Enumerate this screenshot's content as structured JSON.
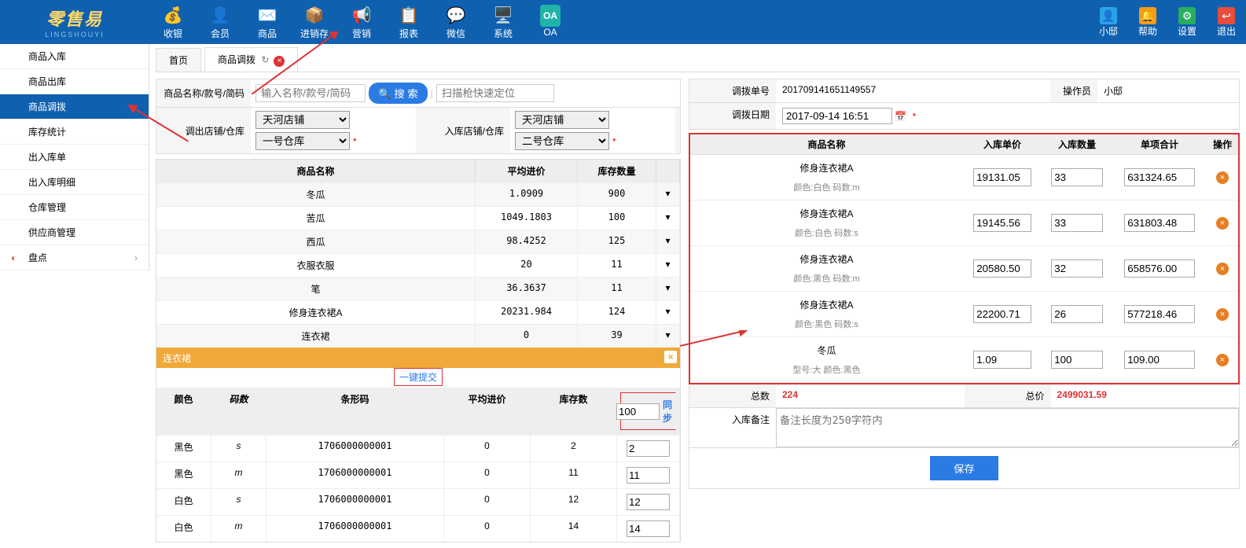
{
  "brand": {
    "name": "零售易",
    "sub": "LINGSHOUYI"
  },
  "topnav": [
    {
      "icon": "💰",
      "label": "收银"
    },
    {
      "icon": "👤",
      "label": "会员"
    },
    {
      "icon": "✉️",
      "label": "商品"
    },
    {
      "icon": "📦",
      "label": "进销存"
    },
    {
      "icon": "📢",
      "label": "营销"
    },
    {
      "icon": "📋",
      "label": "报表"
    },
    {
      "icon": "💬",
      "label": "微信"
    },
    {
      "icon": "🖥️",
      "label": "系统"
    },
    {
      "icon": "OA",
      "label": "OA",
      "oa": true
    }
  ],
  "topnav_right": [
    {
      "icon": "👤",
      "label": "小邸",
      "color": "#2aa3e6"
    },
    {
      "icon": "🔔",
      "label": "帮助",
      "color": "#f39c12"
    },
    {
      "icon": "⚙",
      "label": "设置",
      "color": "#27ae60"
    },
    {
      "icon": "↩",
      "label": "退出",
      "color": "#e74c3c"
    }
  ],
  "sidebar": [
    {
      "label": "商品入库"
    },
    {
      "label": "商品出库"
    },
    {
      "label": "商品调拨",
      "active": true
    },
    {
      "label": "库存统计"
    },
    {
      "label": "出入库单"
    },
    {
      "label": "出入库明细"
    },
    {
      "label": "仓库管理"
    },
    {
      "label": "供应商管理"
    },
    {
      "label": "盘点",
      "group": true
    }
  ],
  "tabs": [
    {
      "label": "首页"
    },
    {
      "label": "商品调拨",
      "active": true,
      "closable": true
    }
  ],
  "search": {
    "label": "商品名称/款号/简码",
    "placeholder": "输入名称/款号/简码",
    "button": "搜 索",
    "scan_placeholder": "扫描枪快速定位"
  },
  "store": {
    "out_label": "调出店铺/仓库",
    "in_label": "入库店铺/仓库",
    "out_store": "天河店铺",
    "out_wh": "一号仓库",
    "in_store": "天河店铺",
    "in_wh": "二号仓库"
  },
  "grid_head": {
    "name": "商品名称",
    "price": "平均进价",
    "qty": "库存数量"
  },
  "grid": [
    {
      "name": "冬瓜",
      "price": "1.0909",
      "qty": "900"
    },
    {
      "name": "苦瓜",
      "price": "1049.1803",
      "qty": "100"
    },
    {
      "name": "西瓜",
      "price": "98.4252",
      "qty": "125"
    },
    {
      "name": "衣服衣服",
      "price": "20",
      "qty": "11"
    },
    {
      "name": "笔",
      "price": "36.3637",
      "qty": "11"
    },
    {
      "name": "修身连衣裙A",
      "price": "20231.984",
      "qty": "124"
    },
    {
      "name": "连衣裙",
      "price": "0",
      "qty": "39"
    }
  ],
  "expand": {
    "title": "连衣裙",
    "oneclick": "一键提交",
    "sync_value": "100",
    "sync_label": "同步",
    "head": {
      "color": "颜色",
      "size": "码数",
      "barcode": "条形码",
      "price": "平均进价",
      "stock": "库存数",
      "in": ""
    },
    "rows": [
      {
        "color": "黑色",
        "size": "s",
        "barcode": "1706000000001",
        "price": "0",
        "stock": "2",
        "in": "2"
      },
      {
        "color": "黑色",
        "size": "m",
        "barcode": "1706000000001",
        "price": "0",
        "stock": "11",
        "in": "11"
      },
      {
        "color": "白色",
        "size": "s",
        "barcode": "1706000000001",
        "price": "0",
        "stock": "12",
        "in": "12"
      },
      {
        "color": "白色",
        "size": "m",
        "barcode": "1706000000001",
        "price": "0",
        "stock": "14",
        "in": "14"
      }
    ]
  },
  "order": {
    "no_label": "调拨单号",
    "no": "201709141651149557",
    "op_label": "操作员",
    "op": "小邸",
    "date_label": "调拨日期",
    "date": "2017-09-14 16:51"
  },
  "thead": {
    "name": "商品名称",
    "price": "入库单价",
    "qty": "入库数量",
    "total": "单项合计",
    "op": "操作"
  },
  "items": [
    {
      "name": "修身连衣裙A",
      "sub": "颜色:白色 码数:m",
      "price": "19131.05",
      "qty": "33",
      "total": "631324.65"
    },
    {
      "name": "修身连衣裙A",
      "sub": "颜色:白色 码数:s",
      "price": "19145.56",
      "qty": "33",
      "total": "631803.48"
    },
    {
      "name": "修身连衣裙A",
      "sub": "颜色:黑色 码数:m",
      "price": "20580.50",
      "qty": "32",
      "total": "658576.00"
    },
    {
      "name": "修身连衣裙A",
      "sub": "颜色:黑色 码数:s",
      "price": "22200.71",
      "qty": "26",
      "total": "577218.46"
    },
    {
      "name": "冬瓜",
      "sub": "型号:大 颜色:黑色",
      "price": "1.09",
      "qty": "100",
      "total": "109.00"
    }
  ],
  "totals": {
    "count_label": "总数",
    "count": "224",
    "sum_label": "总价",
    "sum": "2499031.59"
  },
  "remark": {
    "label": "入库备注",
    "placeholder": "备注长度为250字符内"
  },
  "save": "保存"
}
